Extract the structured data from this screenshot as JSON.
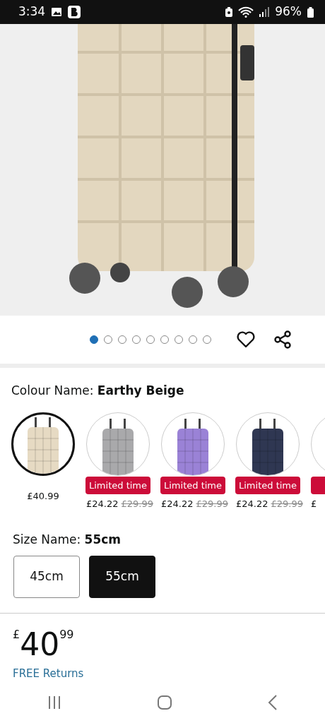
{
  "status_bar": {
    "time": "3:34",
    "battery": "96%"
  },
  "gallery": {
    "dots": [
      {
        "selected": true
      },
      {
        "selected": false
      },
      {
        "selected": false
      },
      {
        "selected": false
      },
      {
        "selected": false
      },
      {
        "selected": false
      },
      {
        "selected": false
      },
      {
        "selected": false
      },
      {
        "selected": false
      }
    ]
  },
  "colour": {
    "label": "Colour Name: ",
    "value": "Earthy Beige",
    "swatches": [
      {
        "selected": true,
        "color": "#e6dac3",
        "limited": false,
        "price": "£40.99"
      },
      {
        "selected": false,
        "color": "#a9a9ab",
        "limited": true,
        "badge": "Limited time",
        "price": "£24.22",
        "was_price": "£29.99"
      },
      {
        "selected": false,
        "color": "#9a82d6",
        "limited": true,
        "badge": "Limited time",
        "price": "£24.22",
        "was_price": "£29.99"
      },
      {
        "selected": false,
        "color": "#2f3752",
        "limited": true,
        "badge": "Limited time",
        "price": "£24.22",
        "was_price": "£29.99"
      },
      {
        "selected": false,
        "limited": true,
        "price": "£"
      }
    ]
  },
  "size": {
    "label": "Size Name: ",
    "value": "55cm",
    "options": [
      {
        "label": "45cm",
        "selected": false
      },
      {
        "label": "55cm",
        "selected": true
      }
    ]
  },
  "price": {
    "currency": "£",
    "whole": "40",
    "fraction": "99"
  },
  "returns_link": "FREE Returns"
}
